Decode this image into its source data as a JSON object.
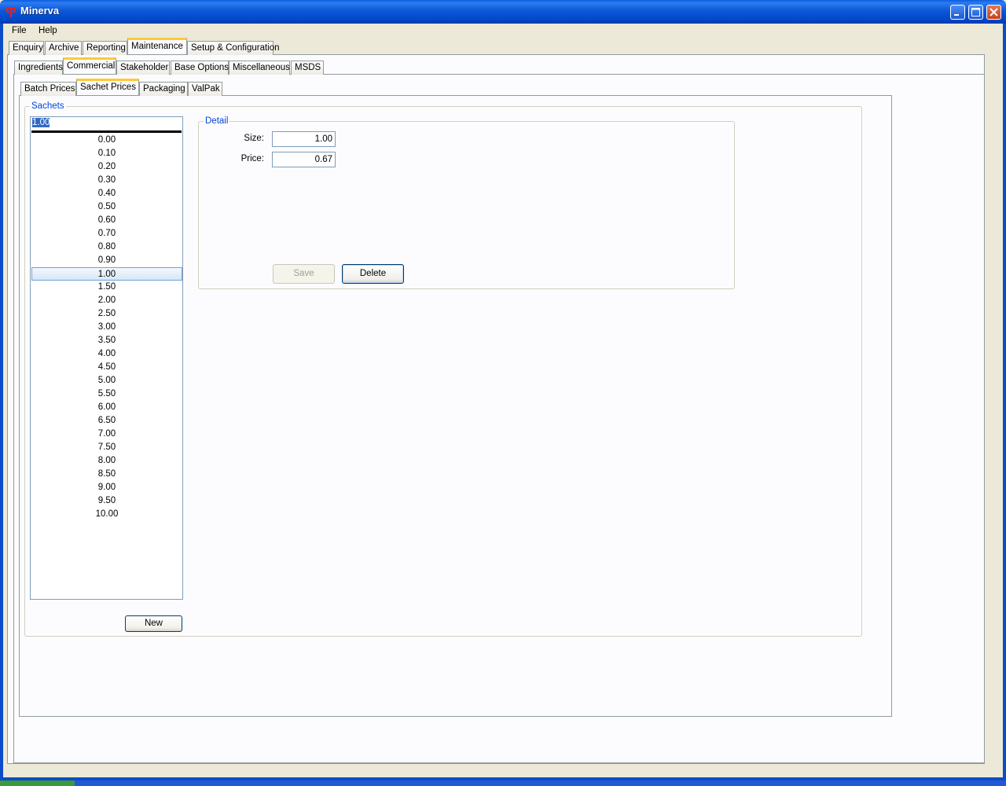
{
  "window": {
    "title": "Minerva",
    "colors": {
      "title_bar": "#0b58d8",
      "tab_highlight": "#ffc83c",
      "group_label": "#0046d5"
    }
  },
  "menu": {
    "items": [
      "File",
      "Help"
    ]
  },
  "main_tabs": [
    "Enquiry",
    "Archive",
    "Reporting",
    "Maintenance",
    "Setup & Configuration"
  ],
  "main_tab_active": "Maintenance",
  "maintenance_tabs": [
    "Ingredients",
    "Commercial",
    "Stakeholder",
    "Base Options",
    "Miscellaneous",
    "MSDS"
  ],
  "commercial_tabs": [
    "Batch Prices",
    "Sachet Prices",
    "Packaging",
    "ValPak"
  ],
  "sachets": {
    "label": "Sachets",
    "input_value": "1.00",
    "items": [
      "0.00",
      "0.10",
      "0.20",
      "0.30",
      "0.40",
      "0.50",
      "0.60",
      "0.70",
      "0.80",
      "0.90",
      "1.00",
      "1.50",
      "2.00",
      "2.50",
      "3.00",
      "3.50",
      "4.00",
      "4.50",
      "5.00",
      "5.50",
      "6.00",
      "6.50",
      "7.00",
      "7.50",
      "8.00",
      "8.50",
      "9.00",
      "9.50",
      "10.00"
    ],
    "selected": "1.00",
    "new_button": "New"
  },
  "detail": {
    "label": "Detail",
    "size_label": "Size:",
    "size_value": "1.00",
    "price_label": "Price:",
    "price_value": "0.67",
    "save_button": "Save",
    "delete_button": "Delete"
  }
}
